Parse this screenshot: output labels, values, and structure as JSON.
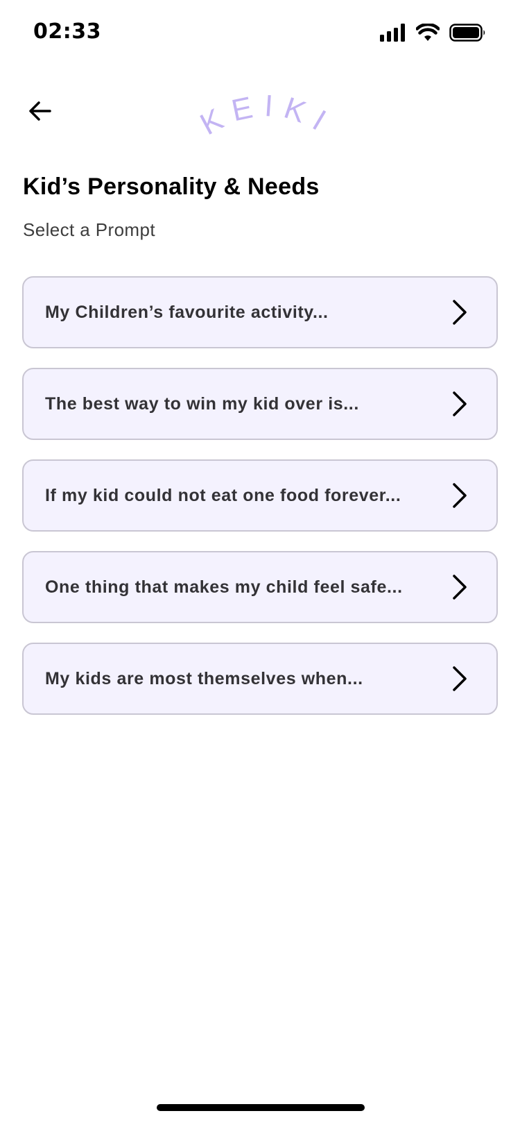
{
  "status_bar": {
    "time": "02:33",
    "icons": [
      "cellular-signal-icon",
      "wifi-icon",
      "battery-icon"
    ]
  },
  "header": {
    "back_icon": "arrow-left-icon",
    "logo_text": "KEIKI",
    "logo_color": "#c3b4f3"
  },
  "page": {
    "title": "Kid’s Personality & Needs",
    "subtitle": "Select a Prompt"
  },
  "prompts": [
    {
      "label": "My Children’s favourite activity...",
      "icon": "chevron-right-icon"
    },
    {
      "label": "The best way to win my kid over is...",
      "icon": "chevron-right-icon"
    },
    {
      "label": "If my kid could not eat one food forever...",
      "icon": "chevron-right-icon"
    },
    {
      "label": "One thing that makes my child feel safe...",
      "icon": "chevron-right-icon"
    },
    {
      "label": "My kids are most themselves when...",
      "icon": "chevron-right-icon"
    }
  ],
  "colors": {
    "card_background": "#f4f2fe",
    "card_border": "#c9c6d3",
    "accent": "#c3b4f3",
    "text_primary": "#000000",
    "text_card": "#333236"
  }
}
